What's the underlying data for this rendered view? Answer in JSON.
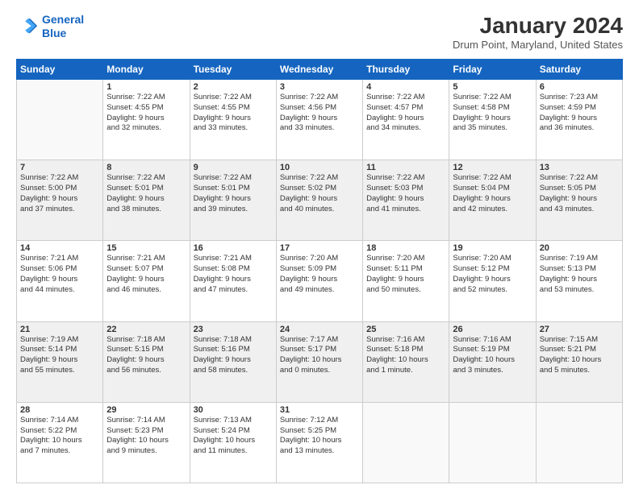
{
  "header": {
    "logo_line1": "General",
    "logo_line2": "Blue",
    "month_year": "January 2024",
    "location": "Drum Point, Maryland, United States"
  },
  "days_of_week": [
    "Sunday",
    "Monday",
    "Tuesday",
    "Wednesday",
    "Thursday",
    "Friday",
    "Saturday"
  ],
  "weeks": [
    [
      {
        "day": "",
        "info": ""
      },
      {
        "day": "1",
        "info": "Sunrise: 7:22 AM\nSunset: 4:55 PM\nDaylight: 9 hours\nand 32 minutes."
      },
      {
        "day": "2",
        "info": "Sunrise: 7:22 AM\nSunset: 4:55 PM\nDaylight: 9 hours\nand 33 minutes."
      },
      {
        "day": "3",
        "info": "Sunrise: 7:22 AM\nSunset: 4:56 PM\nDaylight: 9 hours\nand 33 minutes."
      },
      {
        "day": "4",
        "info": "Sunrise: 7:22 AM\nSunset: 4:57 PM\nDaylight: 9 hours\nand 34 minutes."
      },
      {
        "day": "5",
        "info": "Sunrise: 7:22 AM\nSunset: 4:58 PM\nDaylight: 9 hours\nand 35 minutes."
      },
      {
        "day": "6",
        "info": "Sunrise: 7:23 AM\nSunset: 4:59 PM\nDaylight: 9 hours\nand 36 minutes."
      }
    ],
    [
      {
        "day": "7",
        "info": "Sunrise: 7:22 AM\nSunset: 5:00 PM\nDaylight: 9 hours\nand 37 minutes."
      },
      {
        "day": "8",
        "info": "Sunrise: 7:22 AM\nSunset: 5:01 PM\nDaylight: 9 hours\nand 38 minutes."
      },
      {
        "day": "9",
        "info": "Sunrise: 7:22 AM\nSunset: 5:01 PM\nDaylight: 9 hours\nand 39 minutes."
      },
      {
        "day": "10",
        "info": "Sunrise: 7:22 AM\nSunset: 5:02 PM\nDaylight: 9 hours\nand 40 minutes."
      },
      {
        "day": "11",
        "info": "Sunrise: 7:22 AM\nSunset: 5:03 PM\nDaylight: 9 hours\nand 41 minutes."
      },
      {
        "day": "12",
        "info": "Sunrise: 7:22 AM\nSunset: 5:04 PM\nDaylight: 9 hours\nand 42 minutes."
      },
      {
        "day": "13",
        "info": "Sunrise: 7:22 AM\nSunset: 5:05 PM\nDaylight: 9 hours\nand 43 minutes."
      }
    ],
    [
      {
        "day": "14",
        "info": "Sunrise: 7:21 AM\nSunset: 5:06 PM\nDaylight: 9 hours\nand 44 minutes."
      },
      {
        "day": "15",
        "info": "Sunrise: 7:21 AM\nSunset: 5:07 PM\nDaylight: 9 hours\nand 46 minutes."
      },
      {
        "day": "16",
        "info": "Sunrise: 7:21 AM\nSunset: 5:08 PM\nDaylight: 9 hours\nand 47 minutes."
      },
      {
        "day": "17",
        "info": "Sunrise: 7:20 AM\nSunset: 5:09 PM\nDaylight: 9 hours\nand 49 minutes."
      },
      {
        "day": "18",
        "info": "Sunrise: 7:20 AM\nSunset: 5:11 PM\nDaylight: 9 hours\nand 50 minutes."
      },
      {
        "day": "19",
        "info": "Sunrise: 7:20 AM\nSunset: 5:12 PM\nDaylight: 9 hours\nand 52 minutes."
      },
      {
        "day": "20",
        "info": "Sunrise: 7:19 AM\nSunset: 5:13 PM\nDaylight: 9 hours\nand 53 minutes."
      }
    ],
    [
      {
        "day": "21",
        "info": "Sunrise: 7:19 AM\nSunset: 5:14 PM\nDaylight: 9 hours\nand 55 minutes."
      },
      {
        "day": "22",
        "info": "Sunrise: 7:18 AM\nSunset: 5:15 PM\nDaylight: 9 hours\nand 56 minutes."
      },
      {
        "day": "23",
        "info": "Sunrise: 7:18 AM\nSunset: 5:16 PM\nDaylight: 9 hours\nand 58 minutes."
      },
      {
        "day": "24",
        "info": "Sunrise: 7:17 AM\nSunset: 5:17 PM\nDaylight: 10 hours\nand 0 minutes."
      },
      {
        "day": "25",
        "info": "Sunrise: 7:16 AM\nSunset: 5:18 PM\nDaylight: 10 hours\nand 1 minute."
      },
      {
        "day": "26",
        "info": "Sunrise: 7:16 AM\nSunset: 5:19 PM\nDaylight: 10 hours\nand 3 minutes."
      },
      {
        "day": "27",
        "info": "Sunrise: 7:15 AM\nSunset: 5:21 PM\nDaylight: 10 hours\nand 5 minutes."
      }
    ],
    [
      {
        "day": "28",
        "info": "Sunrise: 7:14 AM\nSunset: 5:22 PM\nDaylight: 10 hours\nand 7 minutes."
      },
      {
        "day": "29",
        "info": "Sunrise: 7:14 AM\nSunset: 5:23 PM\nDaylight: 10 hours\nand 9 minutes."
      },
      {
        "day": "30",
        "info": "Sunrise: 7:13 AM\nSunset: 5:24 PM\nDaylight: 10 hours\nand 11 minutes."
      },
      {
        "day": "31",
        "info": "Sunrise: 7:12 AM\nSunset: 5:25 PM\nDaylight: 10 hours\nand 13 minutes."
      },
      {
        "day": "",
        "info": ""
      },
      {
        "day": "",
        "info": ""
      },
      {
        "day": "",
        "info": ""
      }
    ]
  ]
}
